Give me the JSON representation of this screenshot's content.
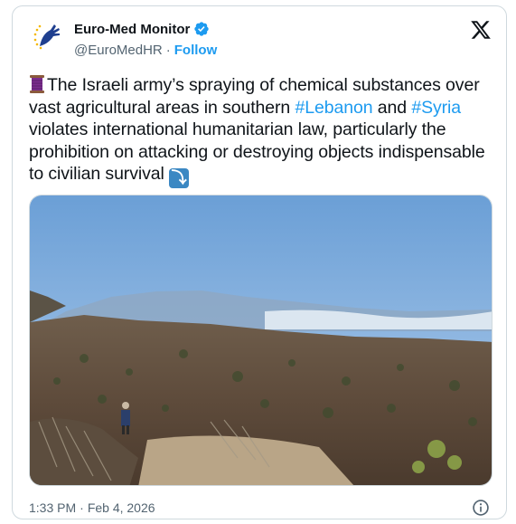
{
  "account": {
    "name": "Euro-Med Monitor",
    "handle": "@EuroMedHR",
    "separator": "·",
    "follow_label": "Follow"
  },
  "tweet": {
    "text_1": "The Israeli army’s spraying of chemical substances over vast agricultural areas in southern ",
    "hashtag_1": "#Lebanon",
    "text_2": " and ",
    "hashtag_2": "#Syria",
    "text_3": " violates international humanitarian law, particularly the prohibition on attacking or destroying objects indispensable to civilian survival ",
    "lead_emoji": "thread-spool-icon",
    "trail_emoji": "right-arrow-curving-down-icon"
  },
  "meta": {
    "time": "1:33 PM",
    "separator": "·",
    "date": "Feb 4, 2026"
  },
  "colors": {
    "link": "#1d9bf0",
    "text": "#0f1419",
    "muted": "#536471",
    "border": "#cfd9de",
    "sky": "#7aa9dc"
  }
}
